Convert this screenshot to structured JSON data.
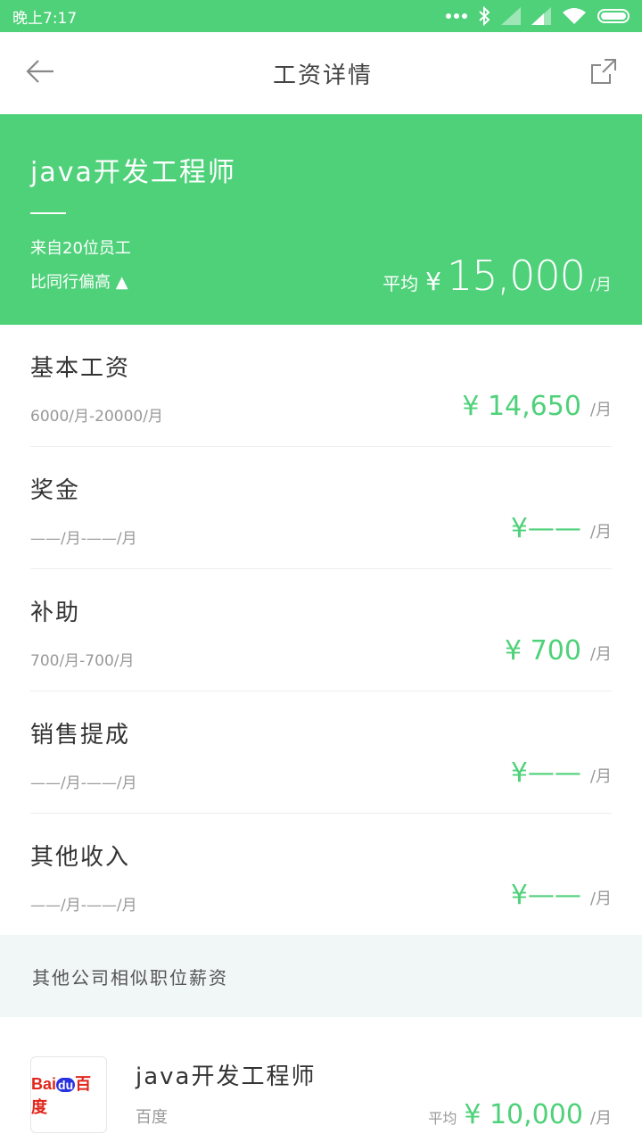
{
  "status": {
    "time": "晚上7:17"
  },
  "nav": {
    "title": "工资详情"
  },
  "hero": {
    "job_title": "java开发工程师",
    "source": "来自20位员工",
    "comparison": "比同行偏高 ▲",
    "avg_label": "平均",
    "currency": "¥",
    "avg_value": "15,000",
    "unit": "/月"
  },
  "items": [
    {
      "name": "基本工资",
      "range": "6000/月-20000/月",
      "amount": "¥ 14,650",
      "unit": "/月"
    },
    {
      "name": "奖金",
      "range": "——/月-——/月",
      "amount": "¥——",
      "unit": "/月"
    },
    {
      "name": "补助",
      "range": "700/月-700/月",
      "amount": "¥ 700",
      "unit": "/月"
    },
    {
      "name": "销售提成",
      "range": "——/月-——/月",
      "amount": "¥——",
      "unit": "/月"
    },
    {
      "name": "其他收入",
      "range": "——/月-——/月",
      "amount": "¥——",
      "unit": "/月"
    }
  ],
  "section": {
    "title": "其他公司相似职位薪资"
  },
  "company": {
    "logo_text_a": "Bai",
    "logo_text_b": "du",
    "logo_text_c": "百度",
    "job_title": "java开发工程师",
    "name": "百度",
    "avg_label": "平均",
    "amount": "¥ 10,000",
    "unit": "/月"
  },
  "colors": {
    "accent": "#4fd17a",
    "section_bg": "#f1f6f7"
  },
  "icons": {
    "back": "back-arrow-icon",
    "share": "share-icon"
  }
}
